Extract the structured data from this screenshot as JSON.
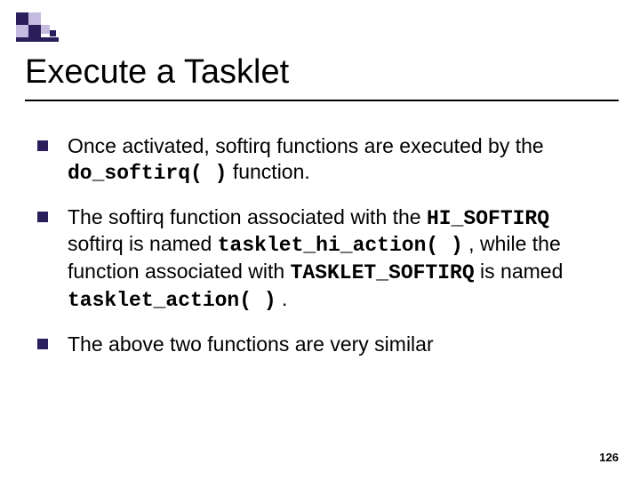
{
  "title": "Execute a Tasklet",
  "bullets": [
    {
      "pre": "Once activated, softirq functions are executed by the ",
      "code1": "do_softirq( )",
      "mid1": " function.",
      "code2": "",
      "mid2": "",
      "code3": "",
      "mid3": "",
      "code4": "",
      "post": ""
    },
    {
      "pre": "The softirq function associated with the ",
      "code1": "HI_SOFTIRQ",
      "mid1": " softirq is named ",
      "code2": "tasklet_hi_action( )",
      "mid2": " , while the function associated with ",
      "code3": "TASKLET_SOFTIRQ",
      "mid3": " is named ",
      "code4": "tasklet_action( )",
      "post": " ."
    },
    {
      "pre": "The above two functions are very similar",
      "code1": "",
      "mid1": "",
      "code2": "",
      "mid2": "",
      "code3": "",
      "mid3": "",
      "code4": "",
      "post": ""
    }
  ],
  "page_number": "126"
}
